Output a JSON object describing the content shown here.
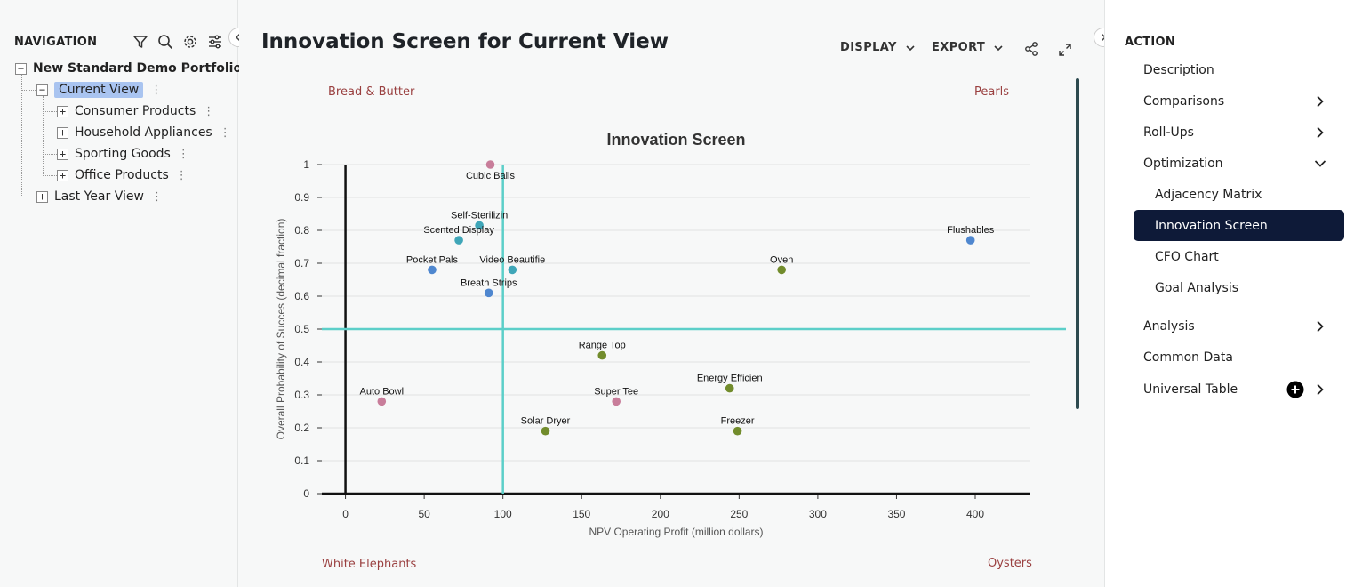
{
  "nav": {
    "header": "NAVIGATION",
    "tree": {
      "root": "New Standard Demo Portfolio",
      "current": "Current View",
      "children": [
        "Consumer Products",
        "Household Appliances",
        "Sporting Goods",
        "Office Products"
      ],
      "last": "Last Year View"
    }
  },
  "main": {
    "title": "Innovation Screen for Current View",
    "display_label": "DISPLAY",
    "export_label": "EXPORT",
    "quadrants": {
      "top_left": "Bread & Butter",
      "top_right": "Pearls",
      "bottom_left": "White Elephants",
      "bottom_right": "Oysters"
    }
  },
  "actions": {
    "header": "ACTION",
    "items": [
      "Description",
      "Comparisons",
      "Roll-Ups",
      "Optimization",
      "Adjacency Matrix",
      "Innovation Screen",
      "CFO Chart",
      "Goal Analysis",
      "Analysis",
      "Common Data",
      "Universal Table"
    ],
    "active": "Innovation Screen"
  },
  "colors": {
    "accent_line": "#5ccfc9",
    "active_bg": "#0e1a38",
    "quadrant_text": "#9a4040",
    "pink": "#c87d9a",
    "blue": "#4f87cf",
    "teal": "#3fa6b8",
    "olive": "#728c2c"
  },
  "chart_data": {
    "type": "scatter",
    "title": "Innovation Screen",
    "xlabel": "NPV Operating Profit (million dollars)",
    "ylabel": "Overall Probability of Succes (decimal fraction)",
    "xlim": [
      -15,
      435
    ],
    "ylim": [
      0,
      1
    ],
    "x_ticks": [
      0,
      50,
      100,
      150,
      200,
      250,
      300,
      350,
      400
    ],
    "y_ticks": [
      0,
      0.1,
      0.2,
      0.3,
      0.4,
      0.5,
      0.6,
      0.7,
      0.8,
      0.9,
      1
    ],
    "y_tick_labels": [
      "0",
      "0.1",
      "0.2",
      "0.3",
      "0.4",
      "0.5",
      "0.6",
      "0.7",
      "0.8",
      "0.9",
      "1"
    ],
    "threshold_x": 100,
    "threshold_y": 0.5,
    "grid": true,
    "points": [
      {
        "label": "Cubic Balls",
        "x": 92,
        "y": 1.0,
        "color": "pink",
        "label_pos": "below"
      },
      {
        "label": "Self-Sterilizin",
        "x": 85,
        "y": 0.815,
        "color": "teal",
        "label_pos": "above"
      },
      {
        "label": "Scented Display",
        "x": 72,
        "y": 0.77,
        "color": "teal",
        "label_pos": "above"
      },
      {
        "label": "Pocket Pals",
        "x": 55,
        "y": 0.68,
        "color": "blue",
        "label_pos": "above"
      },
      {
        "label": "Video Beautifie",
        "x": 106,
        "y": 0.68,
        "color": "teal",
        "label_pos": "above"
      },
      {
        "label": "Breath Strips",
        "x": 91,
        "y": 0.61,
        "color": "blue",
        "label_pos": "above"
      },
      {
        "label": "Flushables",
        "x": 397,
        "y": 0.77,
        "color": "blue",
        "label_pos": "above"
      },
      {
        "label": "Oven",
        "x": 277,
        "y": 0.68,
        "color": "olive",
        "label_pos": "above"
      },
      {
        "label": "Range Top",
        "x": 163,
        "y": 0.42,
        "color": "olive",
        "label_pos": "above"
      },
      {
        "label": "Energy Efficien",
        "x": 244,
        "y": 0.32,
        "color": "olive",
        "label_pos": "above"
      },
      {
        "label": "Auto Bowl",
        "x": 23,
        "y": 0.28,
        "color": "pink",
        "label_pos": "above"
      },
      {
        "label": "Super Tee",
        "x": 172,
        "y": 0.28,
        "color": "pink",
        "label_pos": "above"
      },
      {
        "label": "Solar Dryer",
        "x": 127,
        "y": 0.19,
        "color": "olive",
        "label_pos": "above"
      },
      {
        "label": "Freezer",
        "x": 249,
        "y": 0.19,
        "color": "olive",
        "label_pos": "above"
      }
    ]
  }
}
